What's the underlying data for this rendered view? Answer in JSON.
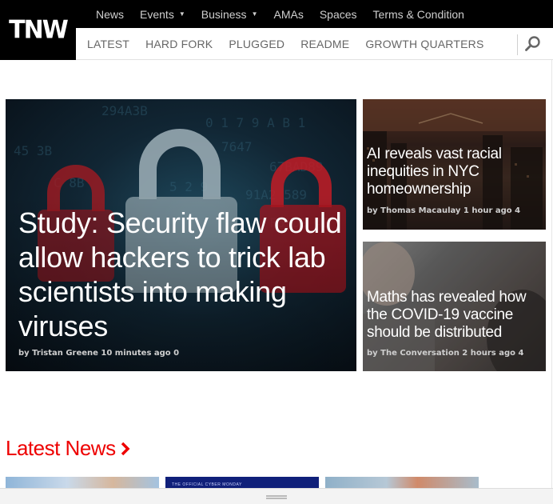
{
  "logo": {
    "text": "TNW"
  },
  "top_nav": [
    {
      "label": "News",
      "dropdown": false
    },
    {
      "label": "Events",
      "dropdown": true
    },
    {
      "label": "Business",
      "dropdown": true
    },
    {
      "label": "AMAs",
      "dropdown": false
    },
    {
      "label": "Spaces",
      "dropdown": false
    },
    {
      "label": "Terms & Condition",
      "dropdown": false
    }
  ],
  "sub_nav": [
    "LATEST",
    "HARD FORK",
    "PLUGGED",
    "README",
    "GROWTH QUARTERS"
  ],
  "search": {
    "icon": "search-icon"
  },
  "hero": {
    "main": {
      "title": "Study: Security flaw could allow hackers to trick lab scientists into making viruses",
      "byline": "by Tristan Greene 10 minutes ago 0"
    },
    "side": [
      {
        "title": "AI reveals vast racial inequities in NYC homeownership",
        "byline": "by Thomas Macaulay 1 hour ago 4"
      },
      {
        "title": "Maths has revealed how the COVID-19 vaccine should be distributed",
        "byline": "by The Conversation 2 hours ago 4"
      }
    ]
  },
  "latest_news": {
    "heading": "Latest News",
    "thumb2_caption": "THE OFFICIAL CYBER MONDAY"
  },
  "colors": {
    "accent": "#e00000",
    "header_bg": "#000000",
    "nav_text": "#666666"
  }
}
